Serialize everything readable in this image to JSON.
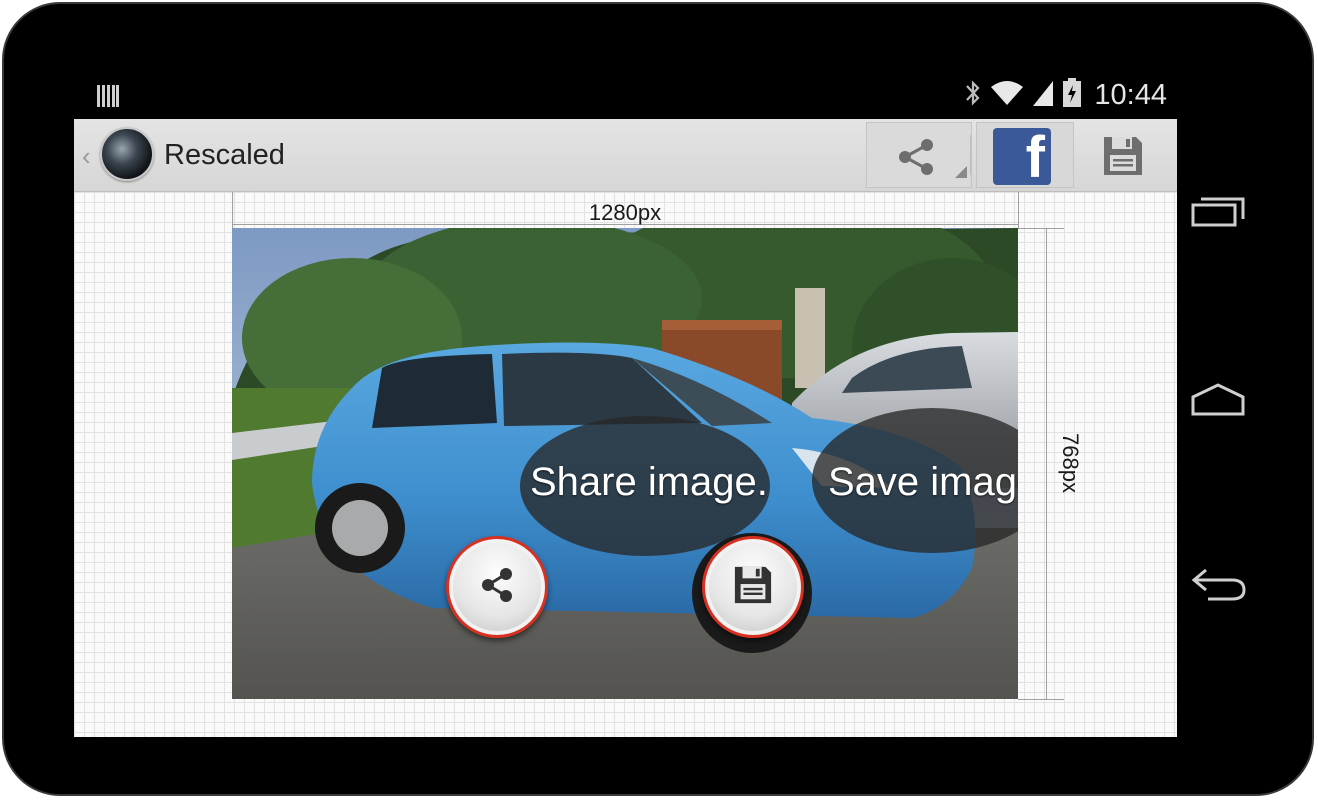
{
  "status_bar": {
    "time": "10:44",
    "icons": [
      "notification-icon",
      "bluetooth-icon",
      "wifi-icon",
      "signal-icon",
      "battery-icon"
    ]
  },
  "action_bar": {
    "title": "Rescaled",
    "actions": [
      "share-icon",
      "facebook-icon",
      "save-icon"
    ],
    "facebook_glyph": "f"
  },
  "canvas": {
    "width_label": "1280px",
    "height_label": "768px"
  },
  "overlay": {
    "share_label": "Share image.",
    "save_label": "Save image."
  },
  "navigation": [
    "recent-apps-icon",
    "home-icon",
    "back-icon"
  ],
  "colors": {
    "facebook": "#3b5998",
    "accent_ring": "#d83020",
    "action_bar": "#dcdcdc"
  }
}
